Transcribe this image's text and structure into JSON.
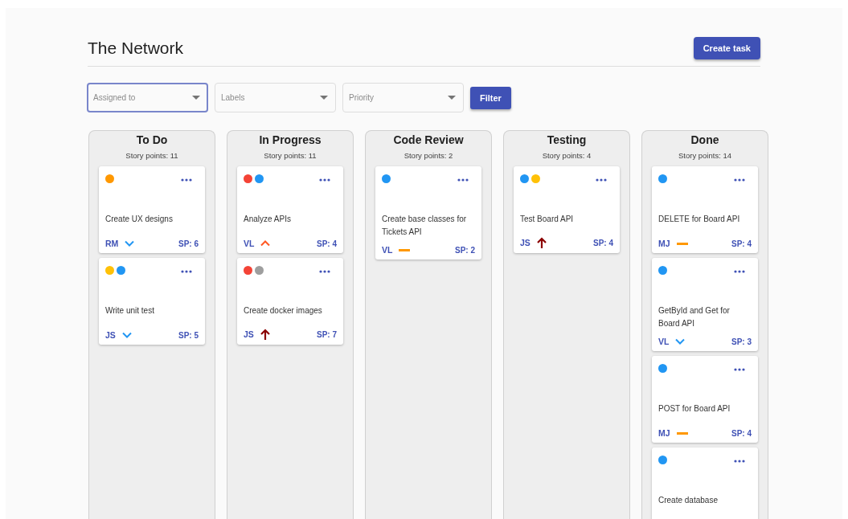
{
  "header": {
    "title": "The Network",
    "create_button": "Create task"
  },
  "filters": [
    {
      "placeholder": "Assigned to",
      "focused": true
    },
    {
      "placeholder": "Labels",
      "focused": false
    },
    {
      "placeholder": "Priority",
      "focused": false
    }
  ],
  "filter_button": "Filter",
  "columns": [
    {
      "title": "To Do",
      "story_points": "Story points: 11",
      "cards": [
        {
          "labels": [
            {
              "color": "#ff9800"
            }
          ],
          "title": "Create UX designs",
          "assignee": "RM",
          "priority": {
            "kind": "low"
          },
          "sp": "SP: 6"
        },
        {
          "labels": [
            {
              "color": "#ffc107"
            },
            {
              "color": "#2196f3"
            }
          ],
          "title": "Write unit test",
          "assignee": "JS",
          "priority": {
            "kind": "low"
          },
          "sp": "SP: 5"
        }
      ]
    },
    {
      "title": "In Progress",
      "story_points": "Story points: 11",
      "cards": [
        {
          "labels": [
            {
              "color": "#f44336"
            },
            {
              "color": "#2196f3"
            }
          ],
          "title": "Analyze APIs",
          "assignee": "VL",
          "priority": {
            "kind": "high"
          },
          "sp": "SP: 4"
        },
        {
          "labels": [
            {
              "color": "#f44336"
            },
            {
              "color": "#9e9e9e"
            }
          ],
          "title": "Create docker images",
          "assignee": "JS",
          "priority": {
            "kind": "highest"
          },
          "sp": "SP: 7"
        }
      ]
    },
    {
      "title": "Code Review",
      "story_points": "Story points: 2",
      "cards": [
        {
          "labels": [
            {
              "color": "#2196f3"
            }
          ],
          "title": "Create base classes for Tickets API",
          "assignee": "VL",
          "priority": {
            "kind": "medium"
          },
          "sp": "SP: 2"
        }
      ]
    },
    {
      "title": "Testing",
      "story_points": "Story points: 4",
      "cards": [
        {
          "labels": [
            {
              "color": "#2196f3"
            },
            {
              "color": "#ffc107"
            }
          ],
          "title": "Test Board API",
          "assignee": "JS",
          "priority": {
            "kind": "highest"
          },
          "sp": "SP: 4"
        }
      ]
    },
    {
      "title": "Done",
      "story_points": "Story points: 14",
      "cards": [
        {
          "labels": [
            {
              "color": "#2196f3"
            }
          ],
          "title": "DELETE for Board API",
          "assignee": "MJ",
          "priority": {
            "kind": "medium"
          },
          "sp": "SP: 4"
        },
        {
          "labels": [
            {
              "color": "#2196f3"
            }
          ],
          "title": "GetById and Get for Board API",
          "assignee": "VL",
          "priority": {
            "kind": "low"
          },
          "sp": "SP: 3"
        },
        {
          "labels": [
            {
              "color": "#2196f3"
            }
          ],
          "title": "POST for Board API",
          "assignee": "MJ",
          "priority": {
            "kind": "medium"
          },
          "sp": "SP: 4"
        },
        {
          "labels": [
            {
              "color": "#2196f3"
            }
          ],
          "title": "Create database"
        }
      ]
    }
  ]
}
